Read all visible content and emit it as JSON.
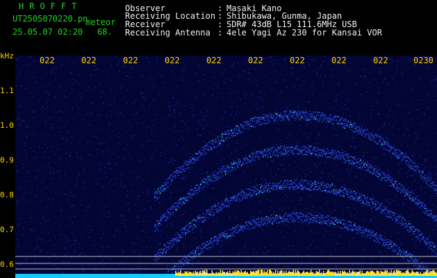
{
  "header": {
    "brand": "HROFFT",
    "filename": "UT2505070220.pn",
    "suffix": "meteor",
    "datetime": "25.05.07 02:20",
    "level": "68.",
    "info": [
      {
        "label": "Observer",
        "value": "Masaki Kano"
      },
      {
        "label": "Receiving Location",
        "value": "Shibukawa, Gunma, Japan"
      },
      {
        "label": "Receiver",
        "value": "SDR# 43dB L15 111.6MHz USB"
      },
      {
        "label": "Receiving Antenna",
        "value": "4ele Yagi Az 230 for Kansai VOR"
      }
    ]
  },
  "spectrogram": {
    "y_unit": "kHz",
    "y_ticks": [
      "1.1",
      "1.0",
      "0.9",
      "0.8",
      "0.7",
      "0.6"
    ],
    "x_ticks": [
      "022",
      "022",
      "022",
      "022",
      "022",
      "022",
      "022",
      "022",
      "022",
      "0230"
    ],
    "colors": {
      "background": "#030535",
      "trace": "#2a4ad8",
      "bright": "#35e6c0",
      "hot": "#ffe020",
      "base": "#14c8ff"
    }
  }
}
